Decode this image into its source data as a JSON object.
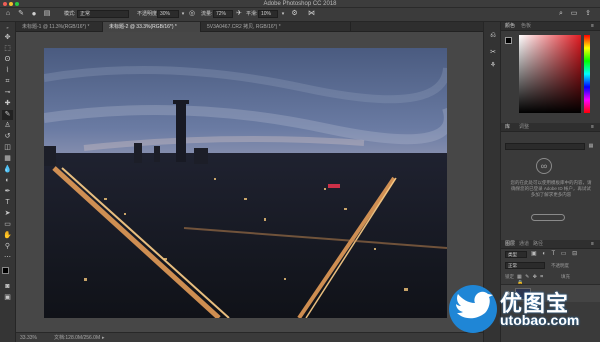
{
  "app": {
    "title": "Adobe Photoshop CC 2018"
  },
  "options_bar": {
    "mode_label": "模式:",
    "mode_value": "正常",
    "opacity_label": "不透明度:",
    "opacity_value": "30%",
    "flow_label": "流量:",
    "flow_value": "72%",
    "smooth_label": "平滑:",
    "smooth_value": "10%"
  },
  "tabs": [
    {
      "label": "未标题-1 @ 11.3%(RGB/16*) *",
      "active": false
    },
    {
      "label": "未标题-2 @ 33.3%(RGB/16*) *",
      "active": true
    },
    {
      "label": "5V3A0467.CR2 拷贝, RGB/16*) *",
      "active": false
    }
  ],
  "status_bar": {
    "zoom": "33.33%",
    "doc": "文档:128.0M/256.0M"
  },
  "panels": {
    "color_tab": "颜色",
    "swatches_tab": "色板",
    "library_tab": "库",
    "adjust_tab": "调整",
    "layers_tab": "图层",
    "channels_tab": "通道",
    "paths_tab": "路径",
    "layer_kind": "类型",
    "blend_mode": "正常",
    "opacity_label": "不透明度",
    "lock_label": "锁定",
    "fill_label": "填充",
    "library_msg": "您的在此处可以使用模板库中的内容，请确保您的已登录 Adobe ID 帐户，再试试多加了解求更多内容"
  },
  "watermark": {
    "brand": "优图宝",
    "url": "utobao.com"
  },
  "colors": {
    "ui_bg": "#535353",
    "panel_bg": "#3a3a3a",
    "accent_blue": "#2a8ad8",
    "selected_fg": "#000000",
    "selected_bg": "#ffffff"
  }
}
